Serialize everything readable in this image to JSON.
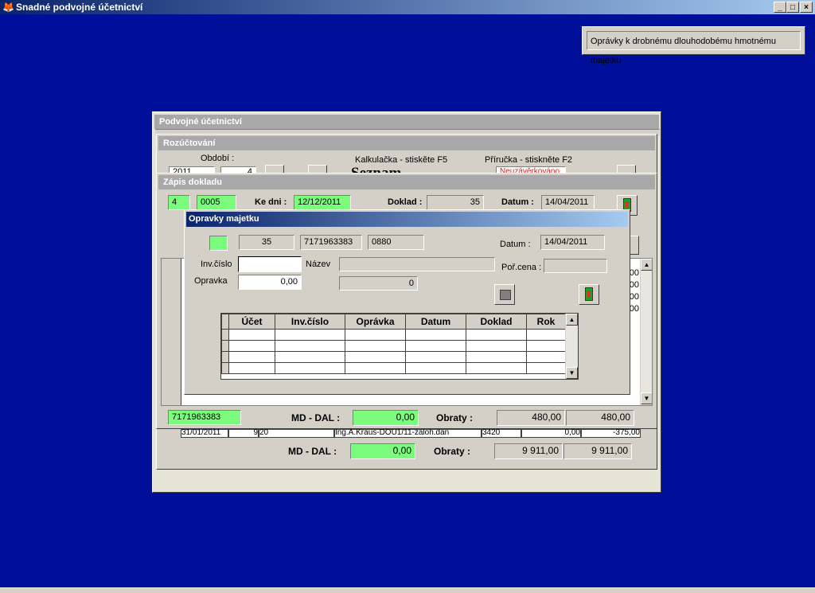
{
  "app": {
    "title": "Snadné podvojné účetnictví",
    "icon": "app-logo-icon",
    "buttons": [
      "_",
      "□",
      "×"
    ]
  },
  "info_box": {
    "text": "Oprávky k drobnému dlouhodobému hmotnému majetku"
  },
  "podvojne": {
    "title": "Podvojné účetnictví"
  },
  "rozuctovani": {
    "title": "Rozúčtování",
    "obdobi_label": "Období :",
    "year": "2011",
    "month": "4",
    "kalkulacka": "Kalkulačka - stiskěte F5",
    "prirucka": "Příručka - stiskněte F2",
    "big_text": "Seznam dokladů",
    "red_text": "Neuzávěrkováno"
  },
  "zapis": {
    "title": "Zápis dokladu",
    "field1": "4",
    "field2": "0005",
    "ke_dni_label": "Ke dni :",
    "ke_dni": "12/12/2011",
    "doklad_label": "Doklad :",
    "doklad": "35",
    "datum_label": "Datum :",
    "datum": "14/04/2011",
    "account": "7171963383",
    "md_dal_label": "MD - DAL :",
    "md_dal": "0,00",
    "obraty_label": "Obraty :",
    "obraty1": "480,00",
    "obraty2": "480,00",
    "right_col_values": [
      "00",
      "00",
      "00",
      "00"
    ]
  },
  "back_row": {
    "date": "31/01/2011",
    "a": "9",
    "b": "20",
    "text": "Ing.A.Kraus-DOU1/11-zaloh.dan",
    "code": "3420",
    "v1": "0,00",
    "v2": "-375,00"
  },
  "bottom": {
    "md_dal_label": "MD - DAL :",
    "md_dal": "0,00",
    "obraty_label": "Obraty :",
    "obraty1": "9 911,00",
    "obraty2": "9 911,00"
  },
  "opravky": {
    "title": "Opravky majetku",
    "doklad": "35",
    "ucet": "7171963383",
    "kod": "0880",
    "datum_label": "Datum :",
    "datum": "14/04/2011",
    "inv_label": "Inv.číslo",
    "inv_value": "",
    "nazev_label": "Název",
    "nazev_value": "",
    "porcena_label": "Poř.cena :",
    "porcena_value": "",
    "opravka_label": "Opravka",
    "opravka_value": "0,00",
    "count": "0",
    "columns": [
      "Účet",
      "Inv.číslo",
      "Oprávka",
      "Datum",
      "Doklad",
      "Rok"
    ],
    "row_count": 4
  },
  "colors": {
    "desktop": "#000f99",
    "green_field": "#7cfc7c",
    "panel": "#d4d0c8"
  }
}
